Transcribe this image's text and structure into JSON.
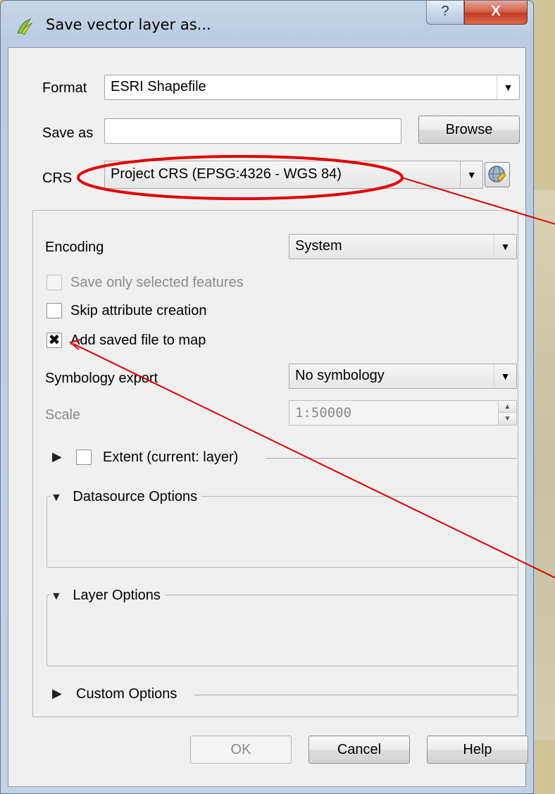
{
  "window": {
    "title": "Save vector layer as...",
    "help_glyph": "?",
    "close_glyph": "X"
  },
  "format": {
    "label": "Format",
    "value": "ESRI Shapefile"
  },
  "save_as": {
    "label": "Save as",
    "value": "",
    "browse_label": "Browse"
  },
  "crs": {
    "label": "CRS",
    "value": "Project CRS (EPSG:4326 - WGS 84)"
  },
  "encoding": {
    "label": "Encoding",
    "value": "System"
  },
  "checkboxes": {
    "save_selected": {
      "label": "Save only selected features",
      "checked": false,
      "enabled": false
    },
    "skip_attr": {
      "label": "Skip attribute creation",
      "checked": false,
      "enabled": true
    },
    "add_to_map": {
      "label": "Add saved file to map",
      "checked": true,
      "enabled": true,
      "mark": "✖"
    }
  },
  "symbology": {
    "label": "Symbology export",
    "value": "No symbology"
  },
  "scale": {
    "label": "Scale",
    "value": "1:50000"
  },
  "sections": {
    "extent": "Extent (current: layer)",
    "datasource": "Datasource Options",
    "layer": "Layer Options",
    "custom": "Custom Options"
  },
  "buttons": {
    "ok": "OK",
    "cancel": "Cancel",
    "help": "Help"
  },
  "icons": {
    "app": "qgis-icon",
    "dropdown": "chevron-down-icon",
    "crs_select": "globe-icon",
    "expanded": "triangle-down-icon",
    "collapsed": "triangle-right-icon"
  },
  "colors": {
    "annotation": "#e00000",
    "titlebar": "#c2d2e5",
    "close": "#c9442a"
  }
}
